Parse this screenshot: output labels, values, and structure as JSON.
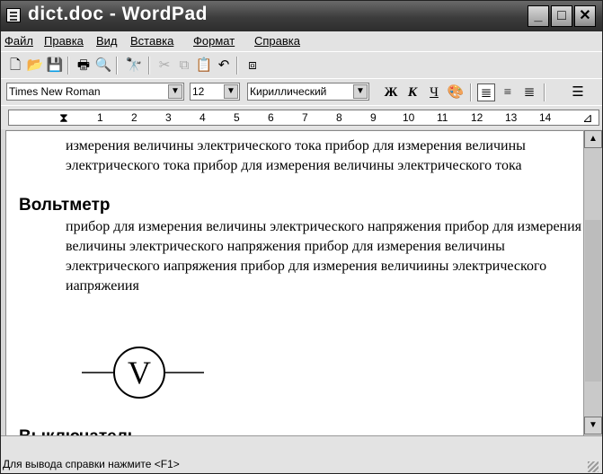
{
  "window": {
    "title": "dict.doc - WordPad"
  },
  "menu": [
    "Файл",
    "Правка",
    "Вид",
    "Вставка",
    "Формат",
    "Справка"
  ],
  "toolbar": {
    "icons": [
      "new-icon",
      "open-icon",
      "save-icon",
      "print-icon",
      "print-preview-icon",
      "find-icon",
      "cut-icon",
      "copy-icon",
      "paste-icon",
      "undo-icon",
      "insert-object-icon"
    ]
  },
  "format": {
    "font": "Times New Roman",
    "size": "12",
    "script": "Кириллический",
    "bold": "Ж",
    "italic": "К",
    "underline": "Ч"
  },
  "ruler": {
    "numbers": [
      "1",
      "2",
      "3",
      "4",
      "5",
      "6",
      "7",
      "8",
      "9",
      "10",
      "11",
      "12",
      "13",
      "14"
    ]
  },
  "document": {
    "para1": "измерения величины электрического тока прибор для измерения величины электрического тока прибор для измерения величины электрического тока",
    "heading1": "Вольтметр",
    "para2": "прибор для измерения величины электрического напряжения прибор для измерения величины электрического напряжения прибор для измерения величины электрического иапряжения прибор для измерения величиины электрического иапряжеиия",
    "symbol_letter": "V",
    "heading2": "Выключатель"
  },
  "status": {
    "text": "Для вывода справки нажмите <F1>"
  }
}
